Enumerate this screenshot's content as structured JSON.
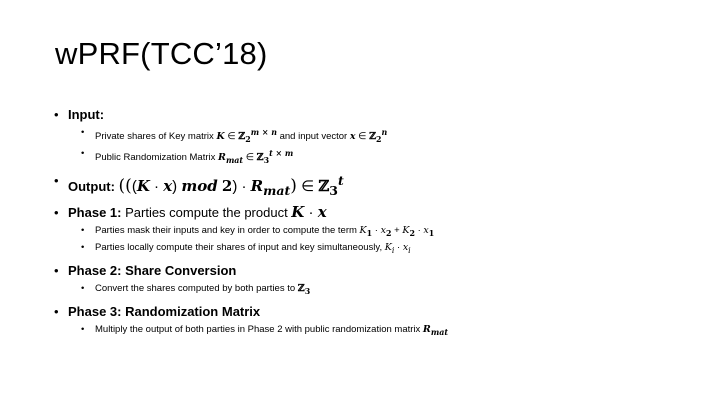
{
  "slide": {
    "title": "wPRF(TCC’18)",
    "items": [
      {
        "label": "Input:",
        "children": [
          {
            "parts": [
              {
                "t": "Private shares of Key matrix "
              },
              {
                "m": "K"
              },
              {
                "t": " ∈ "
              },
              {
                "z": "ℤ"
              },
              {
                "sub": "2"
              },
              {
                "sup": "m × n"
              },
              {
                "t": " and input vector "
              },
              {
                "m": "x"
              },
              {
                "t": " ∈ "
              },
              {
                "z": "ℤ"
              },
              {
                "sub": "2"
              },
              {
                "sup": "n"
              }
            ]
          },
          {
            "parts": [
              {
                "t": "Public Randomization Matrix "
              },
              {
                "m": "R"
              },
              {
                "msub": "mat"
              },
              {
                "t": " ∈ "
              },
              {
                "z": "ℤ"
              },
              {
                "sub": "3"
              },
              {
                "sup": "t × m"
              }
            ]
          }
        ]
      },
      {
        "label": "Output: ",
        "formula": [
          {
            "p": "(("
          },
          {
            "t": "("
          },
          {
            "m": "K"
          },
          {
            "t": " · "
          },
          {
            "m": "x"
          },
          {
            "t": ") "
          },
          {
            "m": "mod"
          },
          {
            "t": " "
          },
          {
            "mb": "2"
          },
          {
            "t": ")"
          },
          {
            "t": " · "
          },
          {
            "m": "R"
          },
          {
            "msub": "mat"
          },
          {
            "p": ")"
          },
          {
            "t": " ∈ "
          },
          {
            "z": "ℤ"
          },
          {
            "sub": "3"
          },
          {
            "sup": "t"
          }
        ]
      },
      {
        "label": "Phase 1:",
        "text": " Parties compute the product ",
        "formula": [
          {
            "m": "K"
          },
          {
            "t": " · "
          },
          {
            "m": "x"
          }
        ],
        "children": [
          {
            "parts": [
              {
                "t": "Parties mask their inputs and key in order to compute the term "
              },
              {
                "i": "K"
              },
              {
                "sub": "1"
              },
              {
                "t": " · "
              },
              {
                "i": "x"
              },
              {
                "sub": "2"
              },
              {
                "t": " + "
              },
              {
                "i": "K"
              },
              {
                "sub": "2"
              },
              {
                "t": " · "
              },
              {
                "i": "x"
              },
              {
                "sub": "1"
              }
            ]
          },
          {
            "parts": [
              {
                "t": "Parties locally compute their shares of input and key simultaneously, "
              },
              {
                "i": "K"
              },
              {
                "isub": "i"
              },
              {
                "t": " · "
              },
              {
                "i": "x"
              },
              {
                "isub": "i"
              }
            ]
          }
        ]
      },
      {
        "label": "Phase 2: Share Conversion",
        "children": [
          {
            "parts": [
              {
                "t": "Convert the shares computed by both parties to "
              },
              {
                "z": "ℤ"
              },
              {
                "sub": "3"
              }
            ]
          }
        ]
      },
      {
        "label": "Phase 3: Randomization Matrix",
        "children": [
          {
            "parts": [
              {
                "t": "Multiply the output of both parties in Phase 2 with public randomization matrix "
              },
              {
                "m": "R"
              },
              {
                "msub": "mat"
              }
            ]
          }
        ]
      }
    ]
  }
}
